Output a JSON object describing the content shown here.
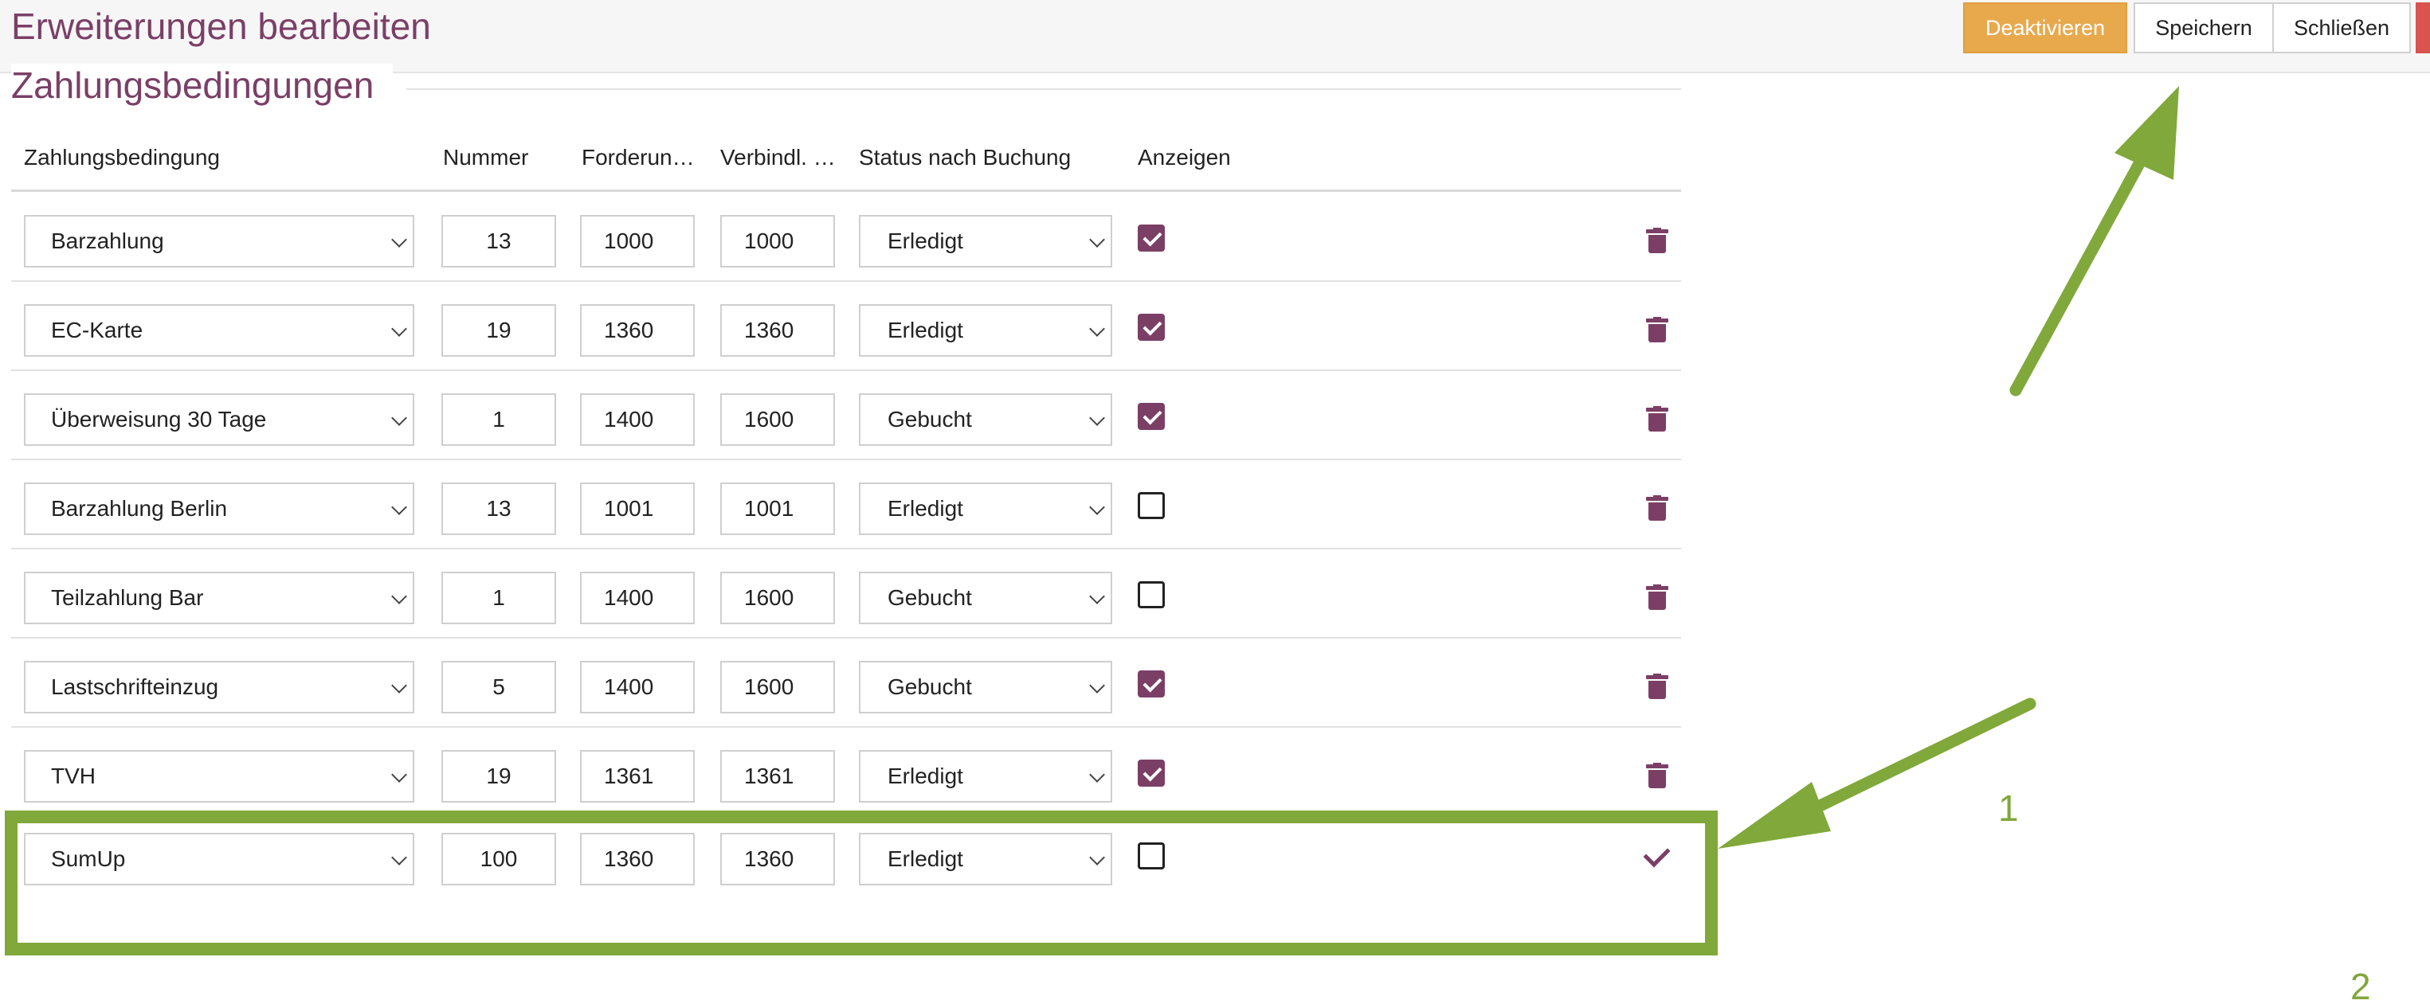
{
  "header": {
    "title": "Erweiterungen bearbeiten",
    "buttons": {
      "deactivate": "Deaktivieren",
      "save": "Speichern",
      "close": "Schließen"
    }
  },
  "section": {
    "title": "Zahlungsbedingungen"
  },
  "table": {
    "columns": {
      "name": "Zahlungsbedingung",
      "number": "Nummer",
      "receivables": "Forderun…",
      "liabilities": "Verbindl. …",
      "status": "Status nach Buchung",
      "display": "Anzeigen"
    },
    "rows": [
      {
        "name": "Barzahlung",
        "number": "13",
        "receivables": "1000",
        "liabilities": "1000",
        "status": "Erledigt",
        "display": true
      },
      {
        "name": "EC-Karte",
        "number": "19",
        "receivables": "1360",
        "liabilities": "1360",
        "status": "Erledigt",
        "display": true
      },
      {
        "name": "Überweisung 30 Tage",
        "number": "1",
        "receivables": "1400",
        "liabilities": "1600",
        "status": "Gebucht",
        "display": true
      },
      {
        "name": "Barzahlung Berlin",
        "number": "13",
        "receivables": "1001",
        "liabilities": "1001",
        "status": "Erledigt",
        "display": false
      },
      {
        "name": "Teilzahlung Bar",
        "number": "1",
        "receivables": "1400",
        "liabilities": "1600",
        "status": "Gebucht",
        "display": false
      },
      {
        "name": "Lastschrifteinzug",
        "number": "5",
        "receivables": "1400",
        "liabilities": "1600",
        "status": "Gebucht",
        "display": true
      },
      {
        "name": "TVH",
        "number": "19",
        "receivables": "1361",
        "liabilities": "1361",
        "status": "Erledigt",
        "display": true
      }
    ],
    "new_row": {
      "name": "SumUp",
      "number": "100",
      "receivables": "1360",
      "liabilities": "1360",
      "status": "Erledigt",
      "display": false
    }
  },
  "annotations": {
    "label_1": "1",
    "label_2": "2",
    "color": "#80a83a"
  },
  "colors": {
    "accent": "#7b3f66",
    "deactivate_button": "#e8a94d"
  },
  "icons": {
    "row_action": "trash-icon",
    "new_row_action": "checkmark-icon",
    "select_arrow": "chevron-down-icon"
  }
}
